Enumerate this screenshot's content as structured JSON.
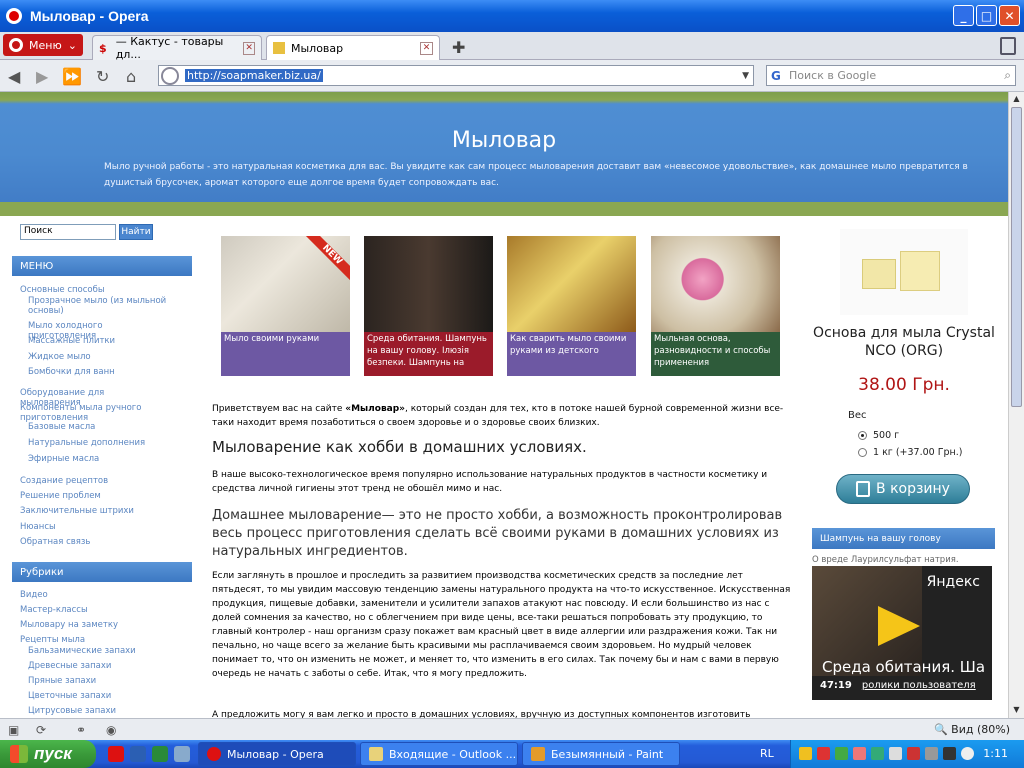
{
  "window": {
    "title": "Мыловар - Opera"
  },
  "browser": {
    "menu_label": "Меню",
    "tabs": [
      {
        "label": "— Кактус - товары дл..."
      },
      {
        "label": "Мыловар"
      }
    ],
    "url": "http://soapmaker.biz.ua/",
    "search_placeholder": "Поиск в Google",
    "zoom": "Вид (80%)"
  },
  "site": {
    "title": "Мыловар",
    "tagline": "Мыло ручной работы - это натуральная косметика для вас. Вы увидите как сам процесс мыловарения доставит вам «невесомое удовольствие», как домашнее мыло превратится в душистый брусочек, аромат которого еще долгое время будет сопровождать вас.",
    "search_value": "Поиск",
    "search_button": "Найти"
  },
  "sidebar": {
    "menu_header": "МЕНЮ",
    "menu_items": [
      {
        "label": "Основные способы",
        "indent": false
      },
      {
        "label": "Прозрачное мыло (из мыльной основы)",
        "indent": true
      },
      {
        "label": "Мыло холодного приготовления",
        "indent": true
      },
      {
        "label": "Массажные плитки",
        "indent": true
      },
      {
        "label": "Жидкое мыло",
        "indent": true
      },
      {
        "label": "Бомбочки для ванн",
        "indent": true
      },
      {
        "label": "Оборудование для мыловарения",
        "indent": false
      },
      {
        "label": "Компоненты мыла ручного приготовления",
        "indent": false
      },
      {
        "label": "Базовые масла",
        "indent": true
      },
      {
        "label": "Натуральные дополнения",
        "indent": true
      },
      {
        "label": "Эфирные масла",
        "indent": true
      },
      {
        "label": "Создание рецептов",
        "indent": false
      },
      {
        "label": "Решение проблем",
        "indent": false
      },
      {
        "label": "Заключительные штрихи",
        "indent": false
      },
      {
        "label": "Нюансы",
        "indent": false
      },
      {
        "label": "Обратная связь",
        "indent": false
      }
    ],
    "rubrics_header": "Рубрики",
    "rubric_items": [
      {
        "label": "Видео",
        "indent": false
      },
      {
        "label": "Мастер-классы",
        "indent": false
      },
      {
        "label": "Мыловару на заметку",
        "indent": false
      },
      {
        "label": "Рецепты мыла",
        "indent": false
      },
      {
        "label": "Бальзамические запахи",
        "indent": true
      },
      {
        "label": "Древесные запахи",
        "indent": true
      },
      {
        "label": "Пряные запахи",
        "indent": true
      },
      {
        "label": "Цветочные запахи",
        "indent": true
      },
      {
        "label": "Цитрусовые запахи",
        "indent": true
      }
    ]
  },
  "thumbnails": [
    {
      "caption": "Мыло своими руками",
      "badge": "NEW",
      "cap_color": "#6d58a3"
    },
    {
      "caption": "Среда обитания. Шампунь на вашу голову. Ілюзія безпеки. Шампунь на",
      "badge": "",
      "cap_color": "#9b1b2a"
    },
    {
      "caption": "Как сварить мыло своими руками из детского",
      "badge": "",
      "cap_color": "#6d58a3"
    },
    {
      "caption": "Мыльная основа, разновидности и способы применения",
      "badge": "",
      "cap_color": "#2e5b3a"
    }
  ],
  "article": {
    "intro_before": "Приветствуем вас на сайте ",
    "intro_bold": "«Мыловар»",
    "intro_after": ", который создан для тех, кто в потоке нашей бурной современной жизни все-таки находит время позаботиться о своем здоровье и о здоровье своих близких.",
    "heading": "Мыловарение как хобби в домашних условиях.",
    "p1": "В наше высоко-технологическое время популярно использование натуральных продуктов в частности косметику и средства личной гигиены этот тренд не обошёл мимо и нас.",
    "subheading": "Домашнее мыловарение— это не просто хобби, а возможность проконтролировав весь процесс приготовления сделать всё своими руками в домашних условиях из натуральных ингредиентов.",
    "p2": "Если заглянуть в прошлое и проследить за развитием производства косметических средств за последние лет пятьдесят, то мы увидим массовую тенденцию замены натурального продукта на что-то искусственное. Искусственная продукция, пищевые добавки, заменители и усилители запахов атакуют нас повсюду. И если большинство из нас с долей сомнения за качество, но с облегчением при виде цены, все-таки решаться попробовать эту продукцию, то главный контролер - наш организм сразу покажет вам красный цвет в виде аллергии или раздражения кожи. Так ни печально, но чаще всего за желание быть красивыми мы расплачиваемся своим здоровьем. Но мудрый человек понимает то, что он изменить не может, и меняет то, что изменить в его силах. Так почему бы и нам с вами в первую очередь не начать с заботы о себе. Итак, что я могу предложить.",
    "p3": "А предложить могу я вам легко и просто в домашних условиях, вручную из доступных компонентов изготовить"
  },
  "product": {
    "title": "Основа для мыла Crystal NCO (ORG)",
    "price": "38.00 Грн.",
    "weight_label": "Вес",
    "options": [
      {
        "label": "500 г",
        "selected": true
      },
      {
        "label": "1 кг (+37.00 Грн.)",
        "selected": false
      }
    ],
    "cart_button": "В корзину"
  },
  "video_widget": {
    "header": "Шампунь на вашу голову",
    "caption": "О вреде Лаурилсульфат натрия.",
    "brand": "Яндекс",
    "title": "Среда обитания. Ша",
    "duration": "47:19",
    "user_link": "ролики пользователя"
  },
  "taskbar": {
    "start_label": "пуск",
    "tasks": [
      {
        "label": "Мыловар - Opera",
        "active": true
      },
      {
        "label": "Входящие - Outlook ...",
        "active": false
      },
      {
        "label": "Безымянный - Paint",
        "active": false
      }
    ],
    "lang": "RL",
    "clock": "1:11"
  }
}
